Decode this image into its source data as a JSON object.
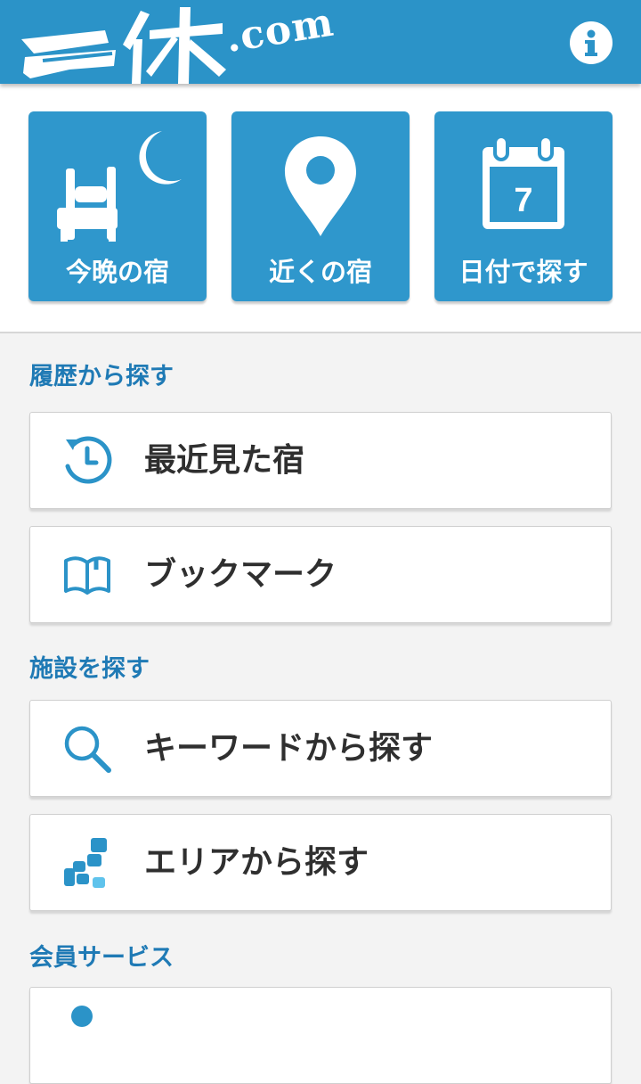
{
  "header": {
    "logo_text": "一休",
    "logo_domain": ".com",
    "info_icon": "info-icon",
    "brand_color": "#2b93c8"
  },
  "quick_buttons": [
    {
      "label": "今晩の宿",
      "icon": "bed-moon-icon"
    },
    {
      "label": "近くの宿",
      "icon": "map-pin-icon"
    },
    {
      "label": "日付で探す",
      "icon": "calendar-icon",
      "calendar_day": "7"
    }
  ],
  "sections": [
    {
      "title": "履歴から探す",
      "items": [
        {
          "label": "最近見た宿",
          "icon": "history-clock-icon"
        },
        {
          "label": "ブックマーク",
          "icon": "open-book-icon"
        }
      ]
    },
    {
      "title": "施設を探す",
      "items": [
        {
          "label": "キーワードから探す",
          "icon": "search-icon"
        },
        {
          "label": "エリアから探す",
          "icon": "area-map-icon"
        }
      ]
    },
    {
      "title": "会員サービス",
      "items": [
        {
          "label": "",
          "icon": "user-icon"
        }
      ]
    }
  ]
}
